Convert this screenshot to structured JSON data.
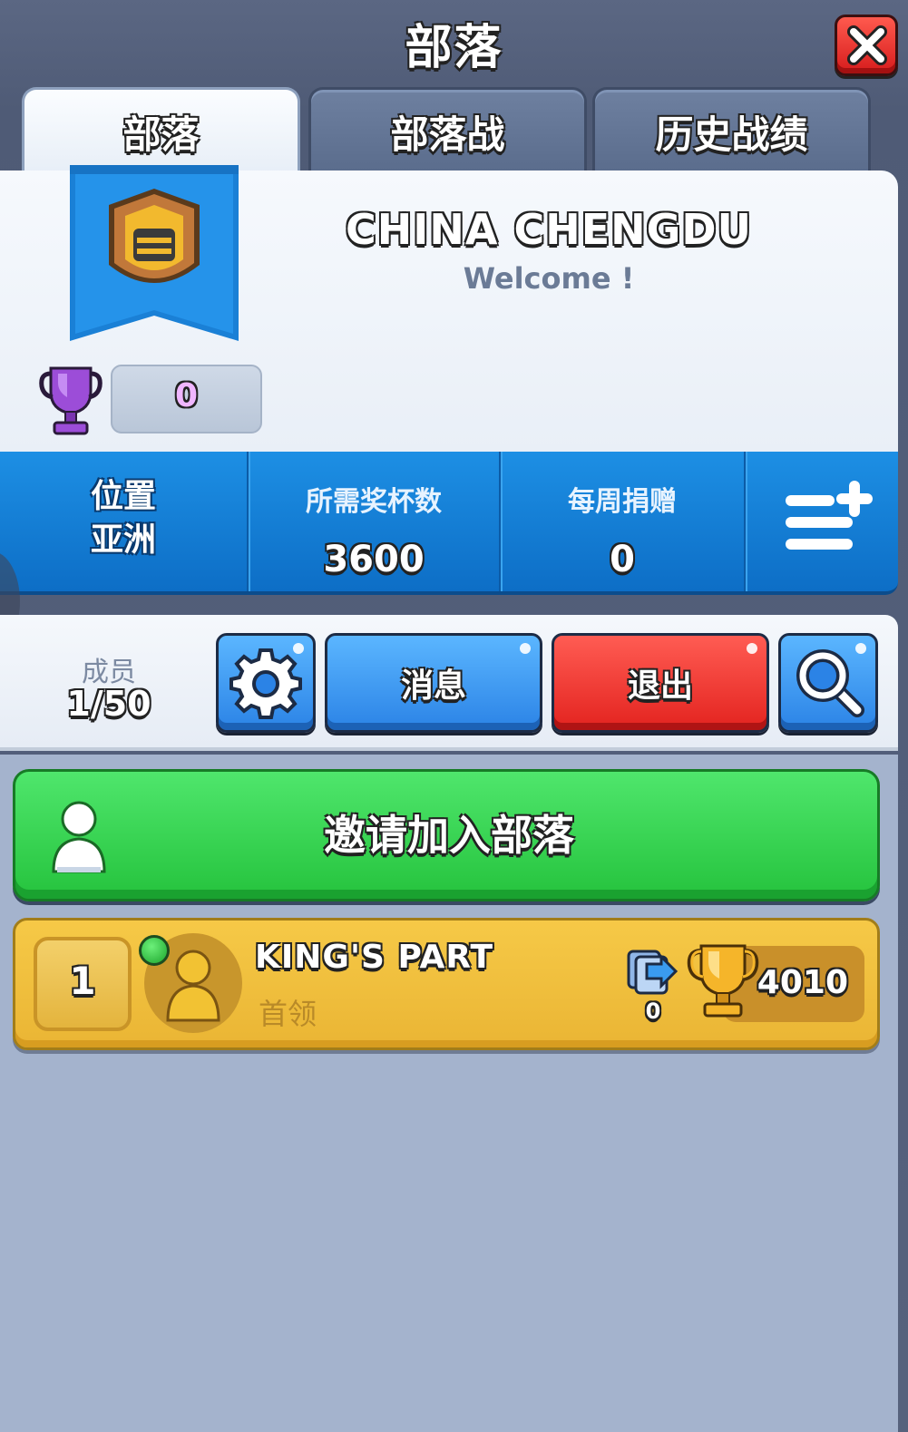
{
  "header": {
    "title": "部落"
  },
  "tabs": [
    {
      "label": "部落",
      "active": true
    },
    {
      "label": "部落战",
      "active": false
    },
    {
      "label": "历史战绩",
      "active": false
    }
  ],
  "clan": {
    "name": "CHINA CHENGDU",
    "description": "Welcome !",
    "trophies": "0"
  },
  "stats": {
    "location_label": "位置",
    "location_value": "亚洲",
    "required_trophies_label": "所需奖杯数",
    "required_trophies_value": "3600",
    "weekly_donations_label": "每周捐赠",
    "weekly_donations_value": "0"
  },
  "members": {
    "label": "成员",
    "count": "1/50"
  },
  "actions": {
    "message_label": "消息",
    "leave_label": "退出",
    "invite_label": "邀请加入部落"
  },
  "member_list": [
    {
      "rank": "1",
      "name": "KING'S PART",
      "role": "首领",
      "donations": "0",
      "trophies": "4010",
      "online": true
    }
  ],
  "colors": {
    "accent_blue": "#1d8fe4",
    "leave_red": "#e3231f",
    "invite_green": "#25c33d",
    "member_gold": "#eab534"
  },
  "icons": [
    "close-icon",
    "shield-icon",
    "trophy-icon",
    "menu-add-icon",
    "gear-icon",
    "search-icon",
    "user-icon",
    "trade-icon"
  ]
}
